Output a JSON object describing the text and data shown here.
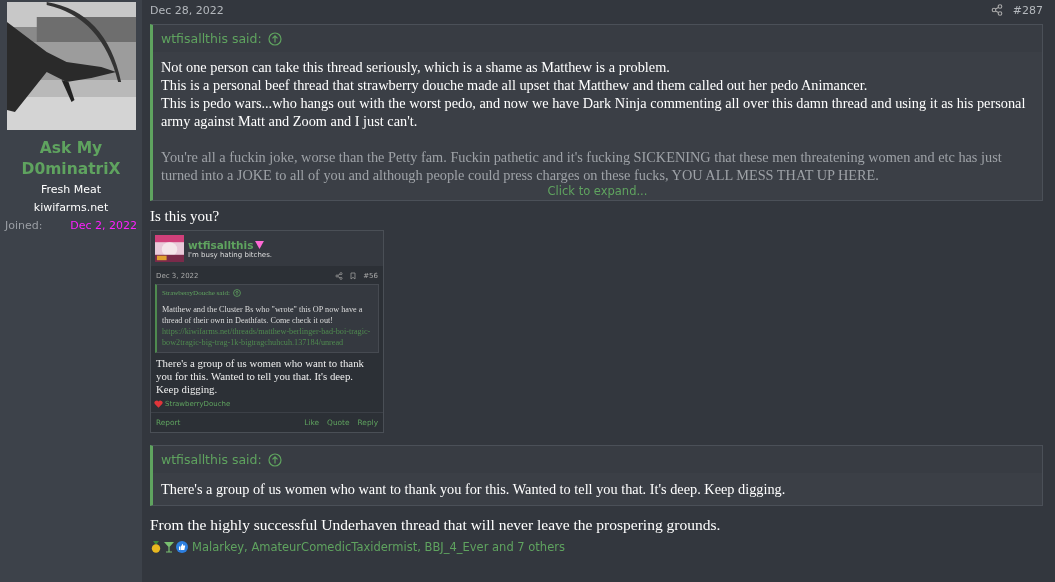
{
  "user": {
    "name": "Ask My D0minatriX",
    "title": "Fresh Meat",
    "banner": "kiwifarms.net",
    "joined_label": "Joined:",
    "joined_value": "Dec 2, 2022"
  },
  "post": {
    "date": "Dec 28, 2022",
    "number": "#287",
    "quote": {
      "author": "wtfisallthis said:",
      "paragraphs": [
        [
          "Not one person can take this thread seriously, which is a shame as Matthew is a problem.",
          "This is a personal beef thread that strawberry douche made all upset that Matthew and them called out her pedo Animancer.",
          "This is pedo wars...who hangs out with the worst pedo, and now we have Dark Ninja commenting all over this damn thread and using it as his personal army against Matt and Zoom and I just can't."
        ],
        [
          "You're all a fuckin joke, worse than the Petty fam. Fuckin pathetic and it's fucking SICKENING that these men threatening women and etc has just turned into a JOKE to all of you and although people could press charges on these fucks, YOU ALL MESS THAT UP HERE."
        ]
      ],
      "expand": "Click to expand..."
    },
    "intro": "Is this you?",
    "embed": {
      "name": "wtfisallthis",
      "status": "I'm busy hating bitches.",
      "date": "Dec 3, 2022",
      "number": "#56",
      "quote_author": "StrawberryDouche said:",
      "quote_text": "Matthew and the Cluster Bs who \"wrote\" this OP now have a thread of their own in Deathfats. Come check it out!",
      "quote_link": "https://kiwifarms.net/threads/matthew-berlinger-bad-boi-tragic-bow2tragic-big-trag-1k-bigtragchuhcuh.137184/unread",
      "body": "There's a group of us women who want to thank you for this. Wanted to tell you that. It's deep. Keep digging.",
      "reaction": "StrawberryDouche",
      "actions_left": [
        "Report"
      ],
      "actions_right": [
        "Like",
        "Quote",
        "Reply"
      ]
    },
    "quote2": {
      "author": "wtfisallthis said:",
      "text": "There's a group of us women who want to thank you for this. Wanted to tell you that. It's deep. Keep digging."
    },
    "text": "From the highly successful Underhaven thread that will never leave the prospering grounds.",
    "reactions": "Malarkey, AmateurComedicTaxidermist, BBJ_4_Ever and 7 others"
  }
}
